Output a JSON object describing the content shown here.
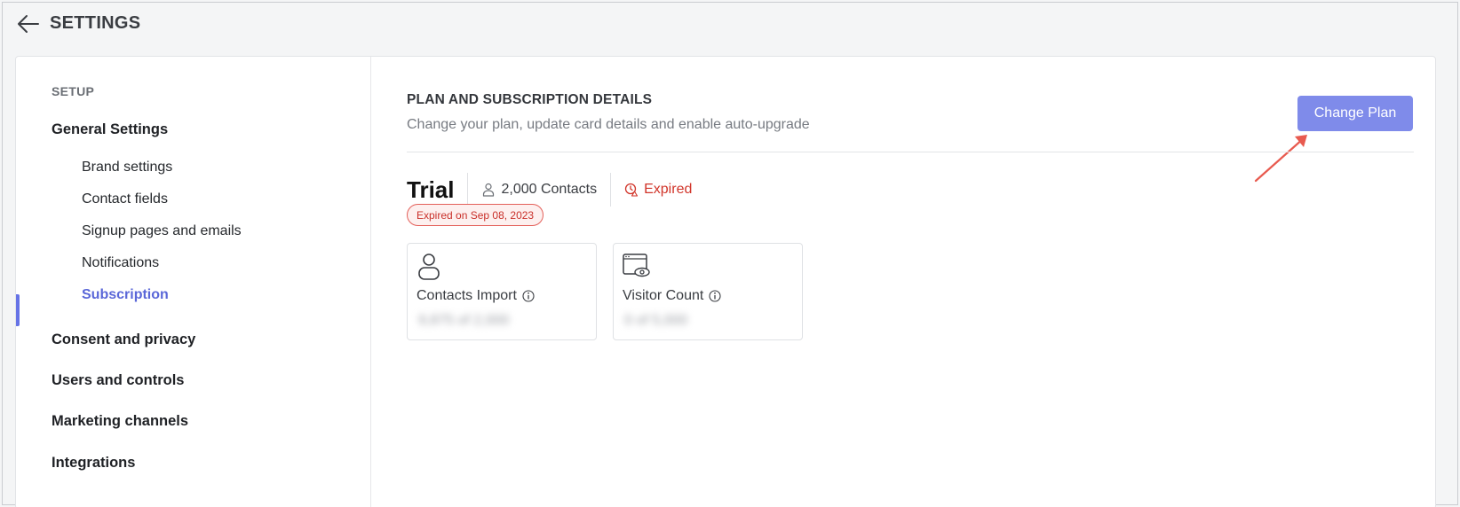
{
  "header": {
    "title": "SETTINGS",
    "back_icon": "arrow-left-icon"
  },
  "sidebar": {
    "section_label": "SETUP",
    "groups": [
      {
        "label": "General Settings",
        "items": [
          {
            "label": "Brand settings",
            "active": false
          },
          {
            "label": "Contact fields",
            "active": false
          },
          {
            "label": "Signup pages and emails",
            "active": false
          },
          {
            "label": "Notifications",
            "active": false
          },
          {
            "label": "Subscription",
            "active": true
          }
        ]
      },
      {
        "label": "Consent and privacy"
      },
      {
        "label": "Users and controls"
      },
      {
        "label": "Marketing channels"
      },
      {
        "label": "Integrations"
      }
    ]
  },
  "main": {
    "section_title": "PLAN AND SUBSCRIPTION DETAILS",
    "section_subtitle": "Change your plan, update card details and enable auto-upgrade",
    "change_plan_label": "Change Plan",
    "plan": {
      "name": "Trial",
      "contacts": "2,000 Contacts",
      "status": "Expired",
      "expired_on": "Expired on Sep 08, 2023"
    },
    "usage_cards": [
      {
        "label": "Contacts Import",
        "value": "9,875 of 2,000",
        "icon": "user-icon"
      },
      {
        "label": "Visitor Count",
        "value": "0 of 5,000",
        "icon": "browser-eye-icon"
      }
    ]
  },
  "colors": {
    "accent": "#5a67d8",
    "button": "#7f8bea",
    "expired": "#d1352a",
    "annotation_arrow": "#e85a4f"
  }
}
